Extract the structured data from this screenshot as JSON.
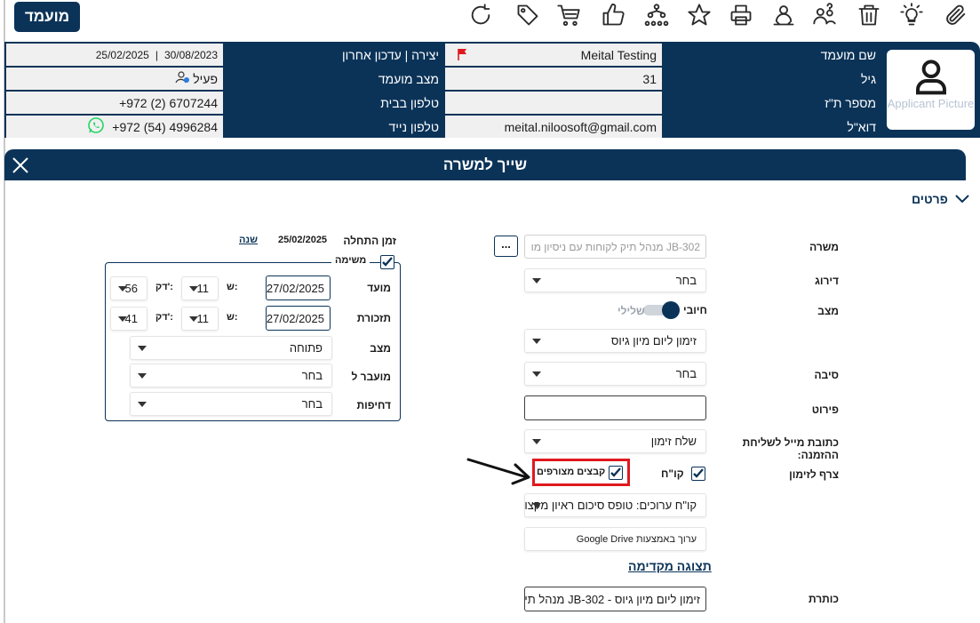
{
  "toolbar": {
    "candidate_button": "מועמד",
    "icons": [
      "paperclip-icon",
      "lightbulb-icon",
      "trash-icon",
      "users-question-icon",
      "user-transfer-icon",
      "print-icon",
      "star-icon",
      "org-chart-icon",
      "thumbs-up-icon",
      "cart-icon",
      "tag-icon",
      "refresh-icon"
    ]
  },
  "info": {
    "labels": {
      "name": "שם מועמד",
      "age": "גיל",
      "id": "מספר ת\"ז",
      "email": "דוא\"ל",
      "created": "יצירה | עדכון אחרון",
      "status": "מצב מועמד",
      "home_phone": "טלפון בבית",
      "mobile": "טלפון נייד"
    },
    "values": {
      "name": "Meital Testing",
      "age": "31",
      "id": "",
      "email": "meital.niloosoft@gmail.com",
      "created": "30/08/2023",
      "updated": "25/02/2025",
      "separator": "|",
      "status": "פעיל",
      "home_phone": "+972 (2) 6707244",
      "mobile": "+972 (54) 4996284"
    },
    "avatar_caption": "Applicant Picture"
  },
  "modal": {
    "title": "שייך למשרה",
    "section": "פרטים",
    "right": {
      "job_label": "משרה",
      "job_placeholder": "JB-302 מנהל תיק לקוחות עם ניסיון מו",
      "more_button": "...",
      "rating_label": "דירוג",
      "rating_value": "בחר",
      "status_label": "מצב",
      "toggle_positive": "חיובי",
      "toggle_negative": "שלילי",
      "status_value": "זימון ליום מיון גיוס",
      "reason_label": "סיבה",
      "reason_value": "בחר",
      "details_label": "פירוט",
      "details_value": "",
      "email_label": "כתובת מייל לשליחת ההזמנה:",
      "email_value": "שלח זימון",
      "attach_label": "צרף לזימון",
      "cv_label": "קו\"ח",
      "attached_files_label": "קבצים מצורפים",
      "cv_value": "קו\"ח ערוכים: טופס סיכום ראיון מקצו",
      "gdrive": "ערוך באמצעות Google Drive",
      "preview": "תצוגה מקדימה",
      "subject_label": "כותרת",
      "subject_value": "זימון ליום מיון גיוס - JB-302 מנהל תיק ל"
    },
    "left": {
      "start_label": "זמן התחלה",
      "start_value": "25/02/2025",
      "year_link": "שנה",
      "task_label": "משימה",
      "due_label": "מועד",
      "due_date": "27/02/2025",
      "due_hour": "11",
      "due_minute": "56",
      "reminder_label": "תזכורת",
      "reminder_date": "27/02/2025",
      "reminder_hour": "11",
      "reminder_minute": "41",
      "hour_label": "ש:",
      "minute_label": "דק':",
      "state_label": "מצב",
      "state_value": "פתוחה",
      "transfer_label": "מועבר ל",
      "transfer_value": "בחר",
      "urgency_label": "דחיפות",
      "urgency_value": "בחר"
    }
  },
  "colors": {
    "primary": "#0b3358",
    "highlight": "#e0191e",
    "flag": "#e0191e",
    "whatsapp": "#25d366"
  }
}
